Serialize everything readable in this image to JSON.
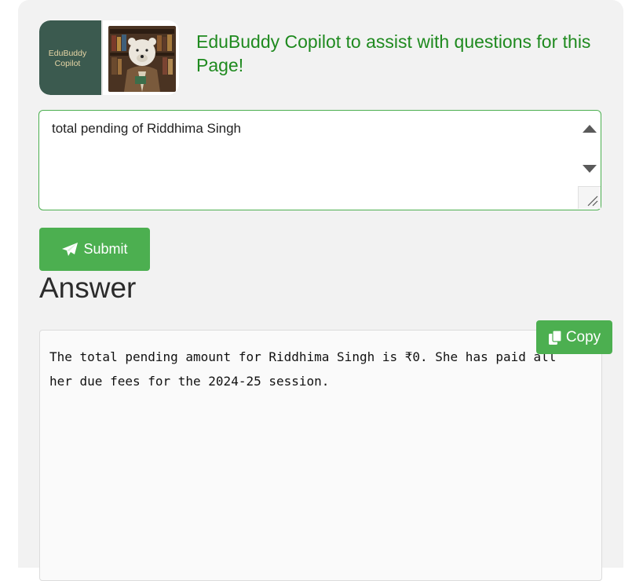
{
  "header": {
    "logo_text": [
      "EduBuddy",
      "Copilot"
    ],
    "title": "EduBuddy Copilot to assist with questions for this Page!"
  },
  "question": {
    "value": "total pending of Riddhima Singh"
  },
  "submit": {
    "label": "Submit",
    "icon": "paper-plane-icon"
  },
  "answer": {
    "heading": "Answer",
    "text": "The total pending amount for Riddhima Singh is ₹0. She has paid all her due fees for the 2024-25 session."
  },
  "copy": {
    "label": "Copy",
    "icon": "copy-icon"
  },
  "colors": {
    "accent": "#4caf50",
    "title": "#1f8a1f",
    "logo_bg": "#3b5a4f"
  }
}
